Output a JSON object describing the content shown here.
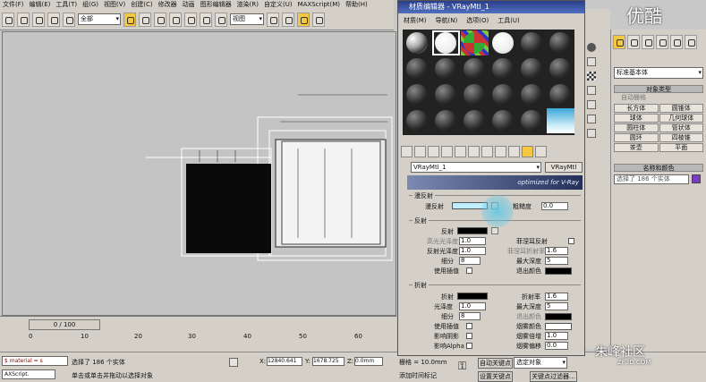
{
  "menubar": [
    "文件(F)",
    "编辑(E)",
    "工具(T)",
    "组(G)",
    "视图(V)",
    "创建(C)",
    "修改器",
    "动画",
    "图形编辑器",
    "渲染(R)",
    "自定义(U)",
    "MAXScript(M)",
    "帮助(H)"
  ],
  "toolbar": {
    "select_filter": "全部",
    "view_combo": "视图"
  },
  "timeline": {
    "frame_label": "0 / 100",
    "ticks": [
      "0",
      "10",
      "20",
      "30",
      "40",
      "50",
      "60"
    ]
  },
  "status": {
    "left_combo": "$ material = s",
    "left_combo2": "AXScript.",
    "selection": "选择了 186 个实体",
    "prompt": "单击或单击并拖动以选择对象",
    "x_label": "X:",
    "x_value": "12840.641",
    "y_label": "Y:",
    "y_value": "1678.725",
    "z_label": "Z:",
    "z_value": "0.0mm",
    "grid": "栅格 = 10.0mm",
    "add_time_tag": "添加时间标记",
    "auto_key": "自动关键点",
    "set_key": "设置关键点",
    "selected_combo": "选定对象",
    "key_filters": "关键点过滤器..."
  },
  "material_editor": {
    "title": "材质编辑器 - VRayMtl_1",
    "menu": [
      "材质(M)",
      "导航(N)",
      "选项(O)",
      "工具(U)"
    ],
    "mat_name": "VRayMtl_1",
    "mat_type": "VRayMtl",
    "banner": "optimized for V-Ray",
    "diffuse_section": "漫反射",
    "diffuse_label": "漫反射",
    "roughness_label": "粗糙度",
    "roughness_value": "0.0",
    "reflect_section": "反射",
    "reflect_label": "反射",
    "hilight_gloss_label": "高光光泽度",
    "hilight_gloss_value": "1.0",
    "fresnel_label": "菲涅耳反射",
    "refl_gloss_label": "反射光泽度",
    "refl_gloss_value": "1.0",
    "fresnel_ior_label": "菲涅耳折射率",
    "fresnel_ior_value": "1.6",
    "subdivs_label": "细分",
    "subdivs_value": "8",
    "max_depth_label": "最大深度",
    "max_depth_value": "5",
    "use_interp_label": "使用插值",
    "exit_color_label": "退出颜色",
    "refract_section": "折射",
    "refract_label": "折射",
    "ior_label": "折射率",
    "ior_value": "1.6",
    "refr_gloss_label": "光泽度",
    "refr_gloss_value": "1.0",
    "refr_max_depth_label": "最大深度",
    "refr_max_depth_value": "5",
    "refr_subdivs_label": "细分",
    "refr_subdivs_value": "8",
    "refr_exit_color_label": "退出颜色",
    "refr_use_interp_label": "使用插值",
    "fog_color_label": "烟雾颜色",
    "affect_shadows_label": "影响阴影",
    "fog_mult_label": "烟雾倍增",
    "fog_mult_value": "1.0",
    "affect_alpha_label": "影响Alpha",
    "fog_bias_label": "烟雾偏移",
    "fog_bias_value": "0.0"
  },
  "command_panel": {
    "type_combo": "标准基本体",
    "object_type_header": "对象类型",
    "autogrid": "自动栅格",
    "objects": [
      "长方体",
      "圆锥体",
      "球体",
      "几何球体",
      "圆柱体",
      "管状体",
      "圆环",
      "四棱锥",
      "茶壶",
      "平面"
    ],
    "name_color_header": "名称和颜色",
    "name_value": "选择了 186 个实体"
  },
  "watermarks": {
    "top_logo": "优酷",
    "bottom_logo": "朱峰社区",
    "bottom_sub": "ZF3D.COM"
  },
  "colors": {
    "diffuse": "#bfefff",
    "accent_yellow": "#f5c842",
    "title_blue": "#2a3e8a"
  }
}
